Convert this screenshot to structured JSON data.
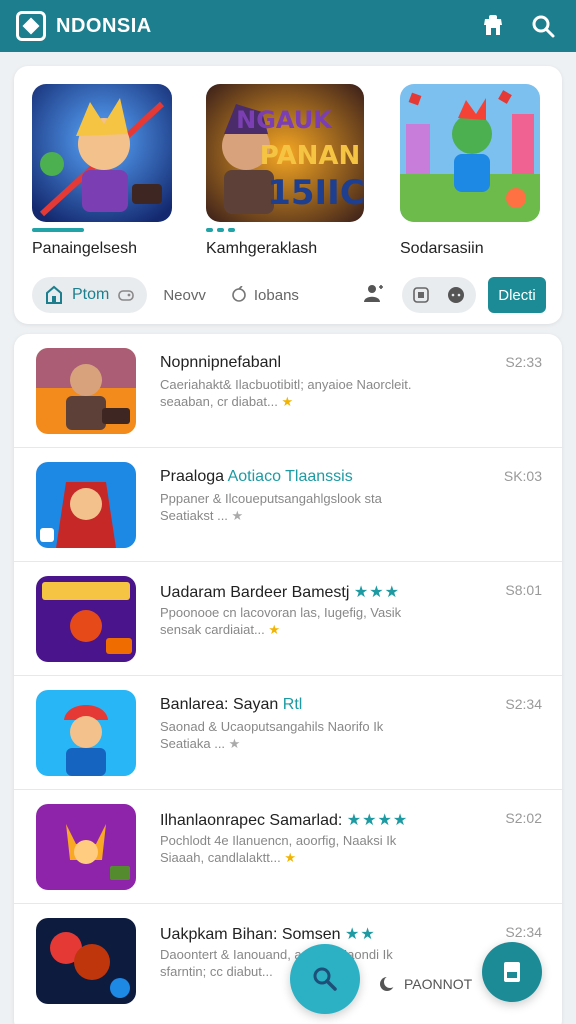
{
  "appbar": {
    "title": "NDONSIA",
    "icons": [
      "store-icon",
      "search-icon"
    ]
  },
  "featured": {
    "cards": [
      {
        "label": "Panaingelsesh",
        "thumb_text": "",
        "colors": [
          "#1e3f8f",
          "#e0322b",
          "#f5c442"
        ]
      },
      {
        "label": "Kamhgeraklash",
        "thumb_text": "NGAUK PANAN 15IIC",
        "colors": [
          "#3a1f1a",
          "#f28b1c",
          "#6b3fb3"
        ]
      },
      {
        "label": "Sodarsasiin",
        "thumb_text": "",
        "colors": [
          "#7cc0f0",
          "#4caf50",
          "#f06292"
        ]
      }
    ]
  },
  "filters": {
    "pill_label": "Ptom",
    "tab2": "Neovv",
    "tab3": "Iobans",
    "button_label": "Dlecti"
  },
  "list": {
    "items": [
      {
        "title": "Nopnnipnefabanl",
        "desc1": "Caeriahakt& Ilacbuotibitl; anyaioe Naorcleit.",
        "desc2": "seaaban, cr diabat...",
        "time": "S2:33",
        "thumb_colors": [
          "#f28b1c",
          "#7b3fb3"
        ]
      },
      {
        "title": "Praaloga",
        "title_tag": "Aotiaco Tlaanssis",
        "desc1": "Pppaner & Ilcoueputsangahlgslook sta",
        "desc2": "Seatiakst ...",
        "time": "SK:03",
        "thumb_colors": [
          "#1e88e5",
          "#c62828"
        ]
      },
      {
        "title": "Uadaram Bardeer Bamestj",
        "title_stars": "★★★",
        "desc1": "Ppoonooe cn lacovoran las, Iugefig, Vasik",
        "desc2": "sensak cardiaiat...",
        "time": "S8:01",
        "thumb_colors": [
          "#4a148c",
          "#ef6c00"
        ]
      },
      {
        "title": "Banlarea: Sayan",
        "title_tag": "Rtl",
        "desc1": "Saonad & Ucaoputsangahils Naorifo Ik",
        "desc2": "Seatiaka ...",
        "time": "S2:34",
        "thumb_colors": [
          "#29b6f6",
          "#e53935"
        ]
      },
      {
        "title": "Ilhanlaonrapec Samarlad:",
        "title_stars": "★★★★",
        "desc1": "Pochlodt 4e Ilanuencn, aoorfig, Naaksi Ik",
        "desc2": "Siaaah, candlalaktt...",
        "time": "S2:02",
        "thumb_colors": [
          "#8e24aa",
          "#f9a825"
        ]
      },
      {
        "title": "Uakpkam Bihan: Somsen",
        "title_stars": "★★",
        "desc1": "Daoontert & Ianouand, aoorfig Naondi Ik",
        "desc2": "sfarntin; cc diabut...",
        "time": "S2:34",
        "thumb_colors": [
          "#0d1b3e",
          "#e53935"
        ]
      }
    ]
  },
  "bottom": {
    "chip_label": "PAONNOT"
  }
}
